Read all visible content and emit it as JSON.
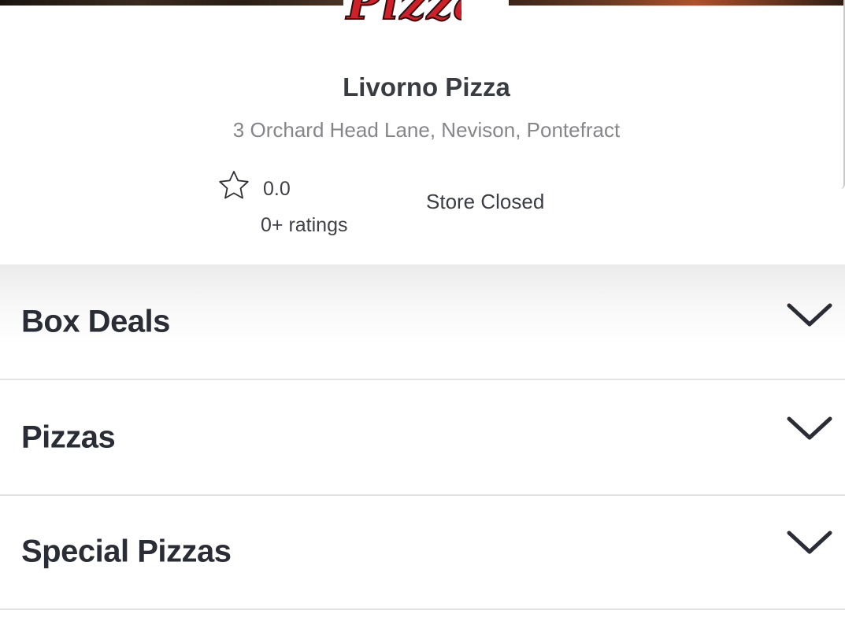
{
  "header": {
    "logo_text": "Pizza"
  },
  "store": {
    "name": "Livorno Pizza",
    "address": "3 Orchard Head Lane, Nevison, Pontefract",
    "rating": "0.0",
    "rating_count": "0+ ratings",
    "status": "Store Closed"
  },
  "menu": {
    "categories": [
      {
        "label": "Box Deals",
        "icon": "chevron-down-icon"
      },
      {
        "label": "Pizzas",
        "icon": "chevron-down-icon"
      },
      {
        "label": "Special Pizzas",
        "icon": "chevron-down-icon"
      }
    ]
  },
  "colors": {
    "logo_red": "#d0202a",
    "text_dark": "#2b2d36",
    "text_muted": "#85868a",
    "divider": "#e2e2e4"
  }
}
